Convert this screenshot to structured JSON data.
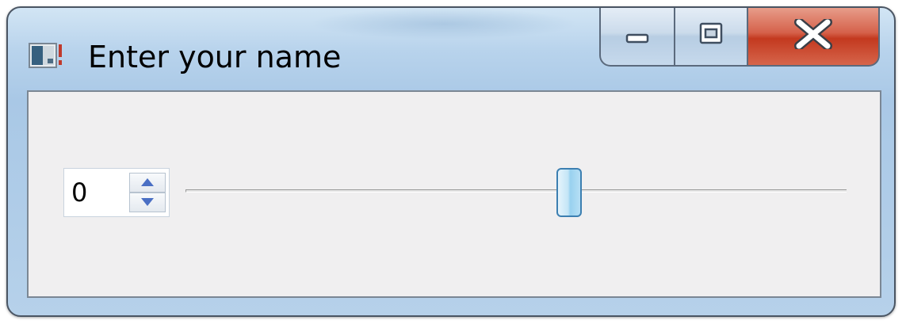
{
  "window": {
    "title": "Enter your name",
    "icon": "application-window-icon",
    "caption_buttons": [
      "minimize-icon",
      "maximize-icon",
      "close-icon"
    ]
  },
  "spinbox": {
    "value": "0",
    "up_icon": "arrow-up-icon",
    "down_icon": "arrow-down-icon"
  },
  "slider": {
    "value_fraction": 0.58
  },
  "colors": {
    "title_bar": "#b8d3ec",
    "client_background": "#f0eff0",
    "close_button": "#c3391f",
    "slider_thumb": "#98d1ef"
  }
}
